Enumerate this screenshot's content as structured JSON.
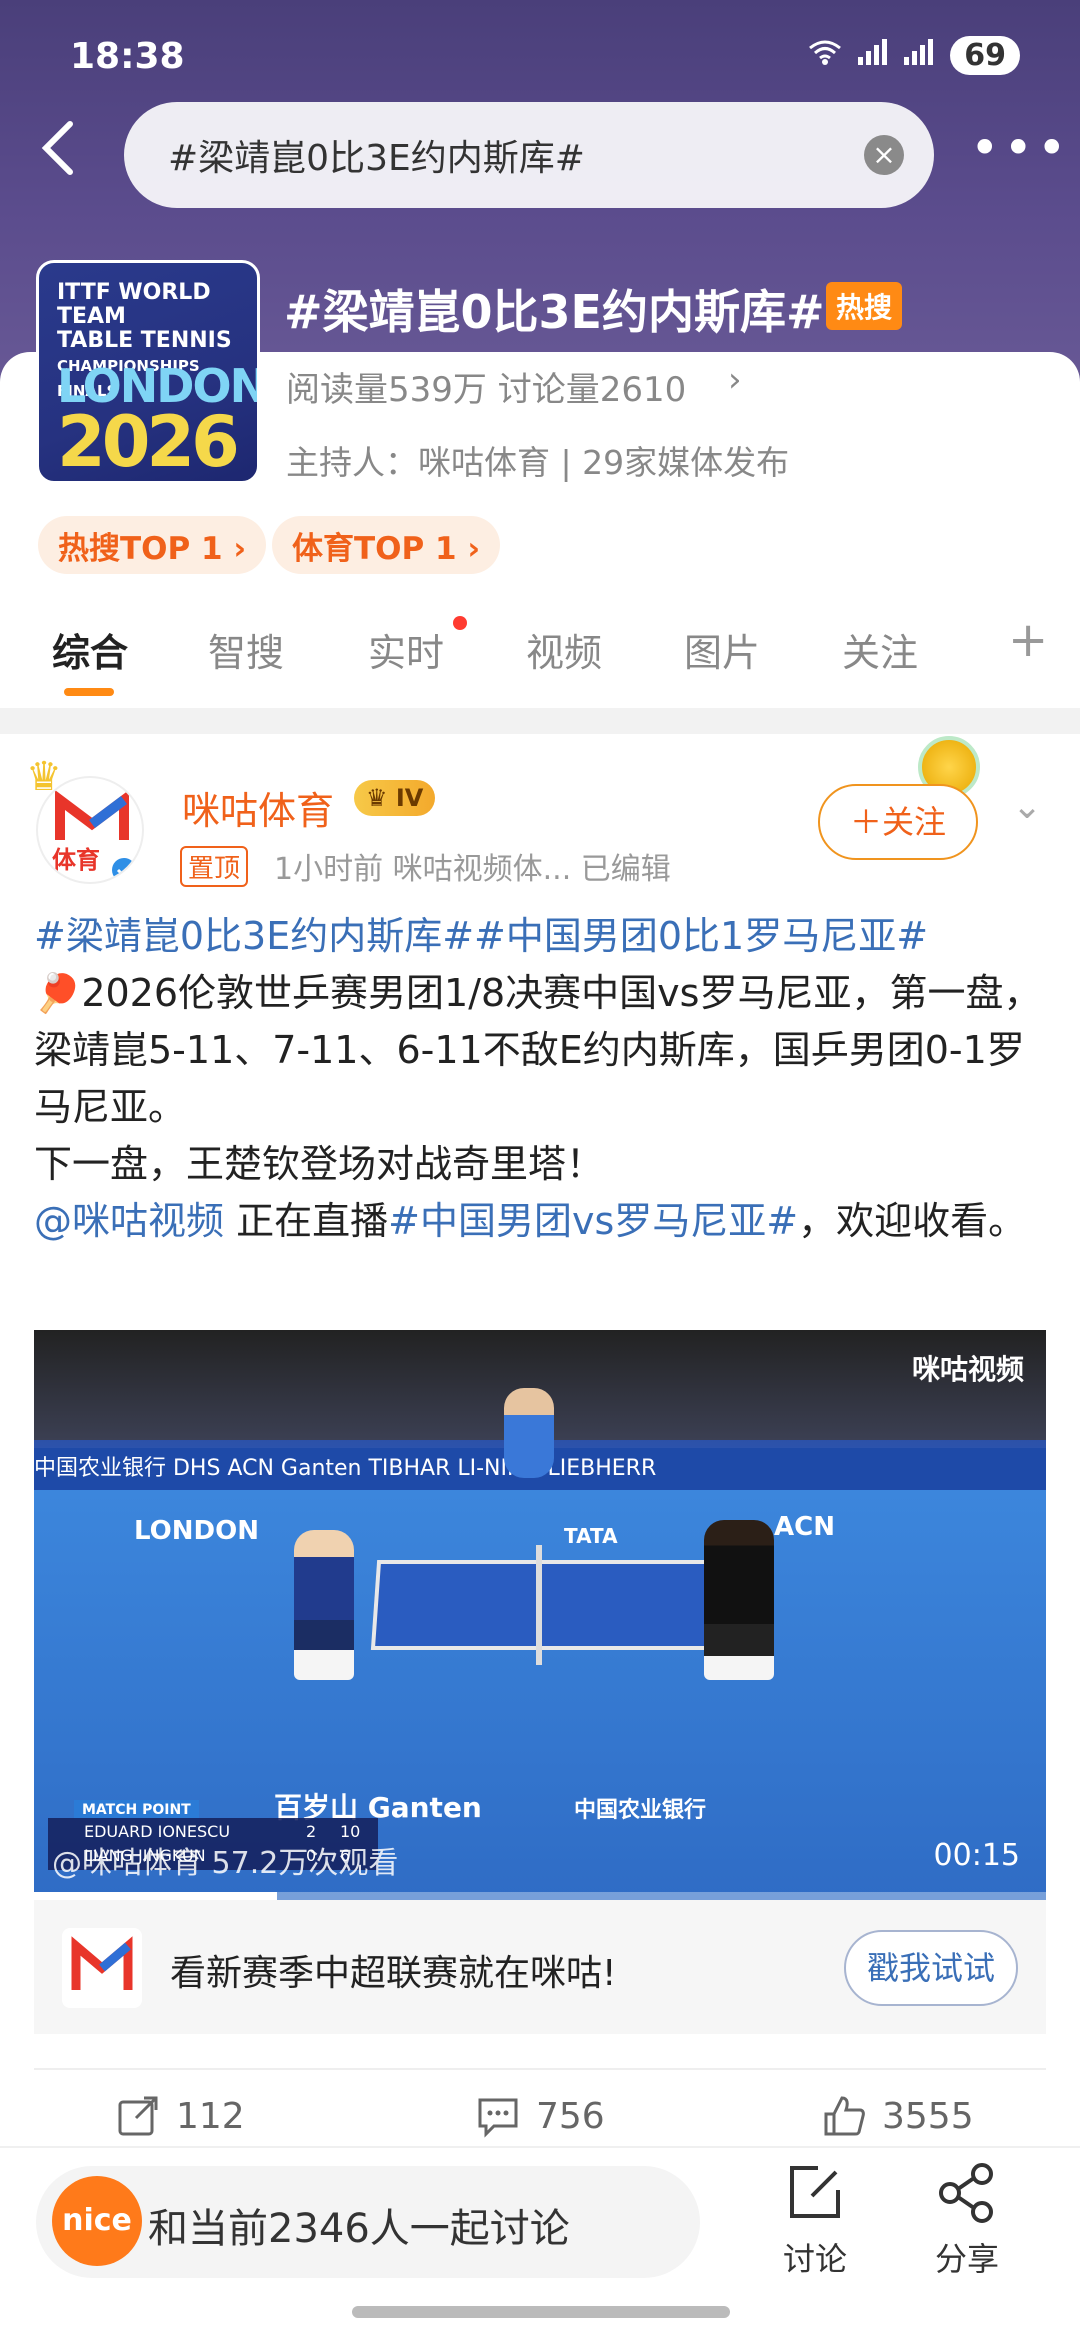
{
  "status_bar": {
    "time": "18:38",
    "battery": "69"
  },
  "search": {
    "query": "#梁靖崑0比3E约内斯库#"
  },
  "topic": {
    "logo_lines": [
      "ITTF WORLD TEAM",
      "TABLE TENNIS",
      "CHAMPIONSHIPS FINALS",
      "LONDON",
      "2026"
    ],
    "title": "#梁靖崑0比3E约内斯库#",
    "hot_badge": "热搜",
    "stats": "阅读量539万  讨论量2610",
    "host": "主持人：咪咕体育 | 29家媒体发布",
    "rank_pills": [
      "热搜TOP 1 ›",
      "体育TOP 1 ›"
    ]
  },
  "tabs": [
    "综合",
    "智搜",
    "实时",
    "视频",
    "图片",
    "关注"
  ],
  "post": {
    "author": "咪咕体育",
    "vip_level": "IV",
    "pin_tag": "置顶",
    "meta": "1小时前  咪咕视频体...  已编辑",
    "follow_label": "＋关注",
    "avatar_text": "体育",
    "body": {
      "line1_links": "#梁靖崑0比3E约内斯库##中国男团0比1罗马尼亚#",
      "para1": "🏓2026伦敦世乒赛男团1/8决赛中国vs罗马尼亚，第一盘，梁靖崑5-11、7-11、6-11不敌E约内斯库，国乒男团0-1罗马尼亚。",
      "para2": "下一盘，王楚钦登场对战奇里塔！",
      "mention": "@咪咕视频",
      "mid_text": " 正在直播",
      "topic_link": "#中国男团vs罗马尼亚#",
      "end_text": "，欢迎收看。"
    }
  },
  "video": {
    "logo": "咪咕视频",
    "watermark": "@咪咕体育 57.2万次观看",
    "time": "00:15",
    "progress": 0.24,
    "match_point": "MATCH POINT",
    "score_rows": [
      {
        "name": "EDUARD IONESCU",
        "sets": "2",
        "points": "10"
      },
      {
        "name": "LIANG JINGKUN",
        "sets": "0",
        "points": "6"
      }
    ],
    "floor_texts": [
      "LONDON",
      "TATA",
      "ACN",
      "百岁山 Ganten",
      "中国农业银行"
    ],
    "ad_board": "中国农业银行   DHS   ACN   Ganten   TIBHAR   LI-NING   LIEBHERR"
  },
  "promo": {
    "text": "看新赛季中超联赛就在咪咕!",
    "button": "戳我试试"
  },
  "actions": {
    "reposts": "112",
    "comments": "756",
    "likes": "3555"
  },
  "bottom": {
    "avatar_text": "nice",
    "discuss_text": "和当前2346人一起讨论",
    "discuss_label": "讨论",
    "share_label": "分享"
  },
  "colors": {
    "accent": "#ff8a14",
    "link": "#3a6fb7",
    "header": "#5b4c8d"
  }
}
